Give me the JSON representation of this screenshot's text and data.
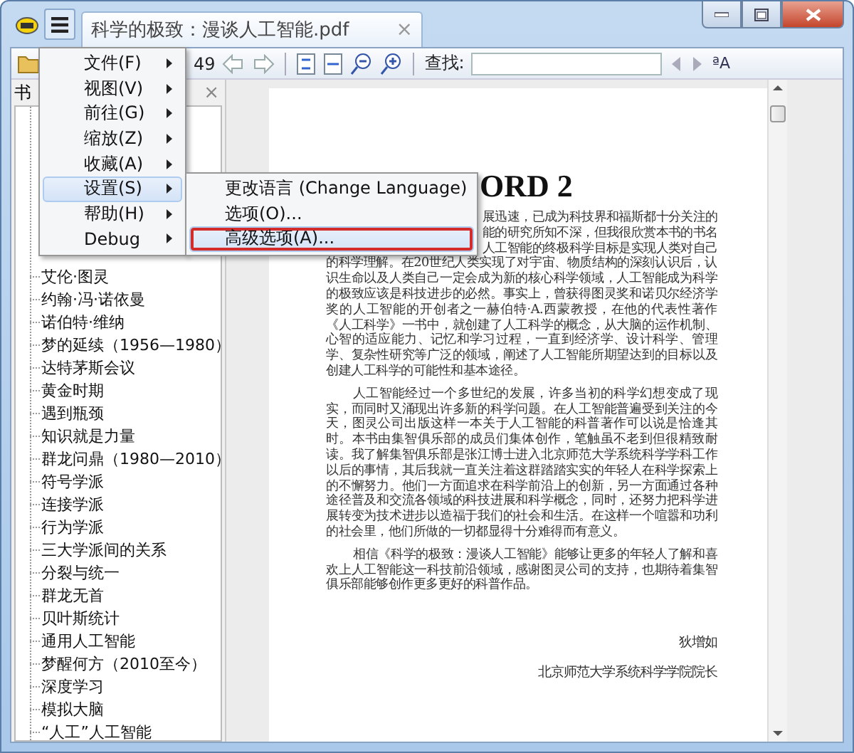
{
  "window": {
    "tab_title": "科学的极致：漫谈人工智能.pdf",
    "tab_close": "×"
  },
  "toolbar": {
    "page_count": "49",
    "find_label": "查找:",
    "match_case": "ªA"
  },
  "sidebar": {
    "title": "书",
    "close": "×",
    "items": [
      {
        "label": "艾伦·图灵"
      },
      {
        "label": "约翰·冯·诺依曼"
      },
      {
        "label": "诺伯特·维纳"
      },
      {
        "label": "梦的延续（1956—1980）"
      },
      {
        "label": "达特茅斯会议"
      },
      {
        "label": "黄金时期"
      },
      {
        "label": "遇到瓶颈"
      },
      {
        "label": "知识就是力量"
      },
      {
        "label": "群龙问鼎（1980—2010）"
      },
      {
        "label": "符号学派"
      },
      {
        "label": "连接学派"
      },
      {
        "label": "行为学派"
      },
      {
        "label": "三大学派间的关系"
      },
      {
        "label": "分裂与统一"
      },
      {
        "label": "群龙无首"
      },
      {
        "label": "贝叶斯统计"
      },
      {
        "label": "通用人工智能"
      },
      {
        "label": "梦醒何方（2010至今）"
      },
      {
        "label": "深度学习"
      },
      {
        "label": "模拟大脑"
      },
      {
        "label": "“人工”人工智能"
      }
    ]
  },
  "page": {
    "heading": "ORD 2",
    "paragraphs": [
      {
        "indented": false,
        "lines": [
          {
            "text": "展迅速，已成为科技界和福斯都十分关注的",
            "covered": true
          },
          {
            "text": "能的研究所知不深，但我很欣赏本书的书名",
            "covered": true
          },
          {
            "text": "人工智能的终极科学目标是实现人类对自己",
            "covered": true
          },
          {
            "text": "的科学理解。在20世纪人类实现了对宇宙、物质结构的深刻认识后，认",
            "covered": false
          },
          {
            "text": "识生命以及人类自己一定会成为新的核心科学领域，人工智能成为科学",
            "covered": false
          },
          {
            "text": "的极致应该是科技进步的必然。事实上，曾获得图灵奖和诺贝尔经济学",
            "covered": false
          },
          {
            "text": "奖的人工智能的开创者之一赫伯特·A.西蒙教授，在他的代表性著作",
            "covered": false
          },
          {
            "text": "《人工科学》一书中，就创建了人工科学的概念，从大脑的运作机制、",
            "covered": false
          },
          {
            "text": "心智的适应能力、记忆和学习过程，一直到经济学、设计科学、管理",
            "covered": false
          },
          {
            "text": "学、复杂性研究等广泛的领域，阐述了人工智能所期望达到的目标以及",
            "covered": false
          },
          {
            "text": "创建人工科学的可能性和基本途径。",
            "covered": false
          }
        ]
      },
      {
        "indented": true,
        "lines": [
          {
            "text": "人工智能经过一个多世纪的发展，许多当初的科学幻想变成了现",
            "covered": false
          },
          {
            "text": "实，而同时又涌现出许多新的科学问题。在人工智能普遍受到关注的今",
            "covered": false
          },
          {
            "text": "天，图灵公司出版这样一本关于人工智能的科普著作可以说是恰逢其",
            "covered": false
          },
          {
            "text": "时。本书由集智俱乐部的成员们集体创作，笔触虽不老到但很精致耐",
            "covered": false
          },
          {
            "text": "读。我了解集智俱乐部是张江博士进入北京师范大学系统科学学科工作",
            "covered": false
          },
          {
            "text": "以后的事情，其后我就一直关注着这群踏踏实实的年轻人在科学探索上",
            "covered": false
          },
          {
            "text": "的不懈努力。他们一方面追求在科学前沿上的创新，另一方面通过各种",
            "covered": false
          },
          {
            "text": "途径普及和交流各领域的科技进展和科学概念，同时，还努力把科学进",
            "covered": false
          },
          {
            "text": "展转变为技术进步以造福于我们的社会和生活。在这样一个喧嚣和功利",
            "covered": false
          },
          {
            "text": "的社会里，他们所做的一切都显得十分难得而有意义。",
            "covered": false
          }
        ]
      },
      {
        "indented": true,
        "lines": [
          {
            "text": "相信《科学的极致：漫谈人工智能》能够让更多的年轻人了解和喜",
            "covered": false
          },
          {
            "text": "欢上人工智能这一科技前沿领域，感谢图灵公司的支持，也期待着集智",
            "covered": false
          },
          {
            "text": "俱乐部能够创作更多更好的科普作品。",
            "covered": false
          }
        ]
      }
    ],
    "signature": [
      "狄增如",
      "北京师范大学系统科学学院院长"
    ]
  },
  "menu": {
    "items": [
      {
        "label": "文件(F)",
        "selected": false
      },
      {
        "label": "视图(V)",
        "selected": false
      },
      {
        "label": "前往(G)",
        "selected": false
      },
      {
        "label": "缩放(Z)",
        "selected": false
      },
      {
        "label": "收藏(A)",
        "selected": false
      },
      {
        "label": "设置(S)",
        "selected": true
      },
      {
        "label": "帮助(H)",
        "selected": false
      },
      {
        "label": "Debug",
        "selected": false
      }
    ],
    "submenu": [
      {
        "label": "更改语言 (Change Language)",
        "selected": false,
        "marked": false
      },
      {
        "label": "选项(O)...",
        "selected": false,
        "marked": false
      },
      {
        "label": "高级选项(A)...",
        "selected": true,
        "marked": true
      }
    ]
  }
}
